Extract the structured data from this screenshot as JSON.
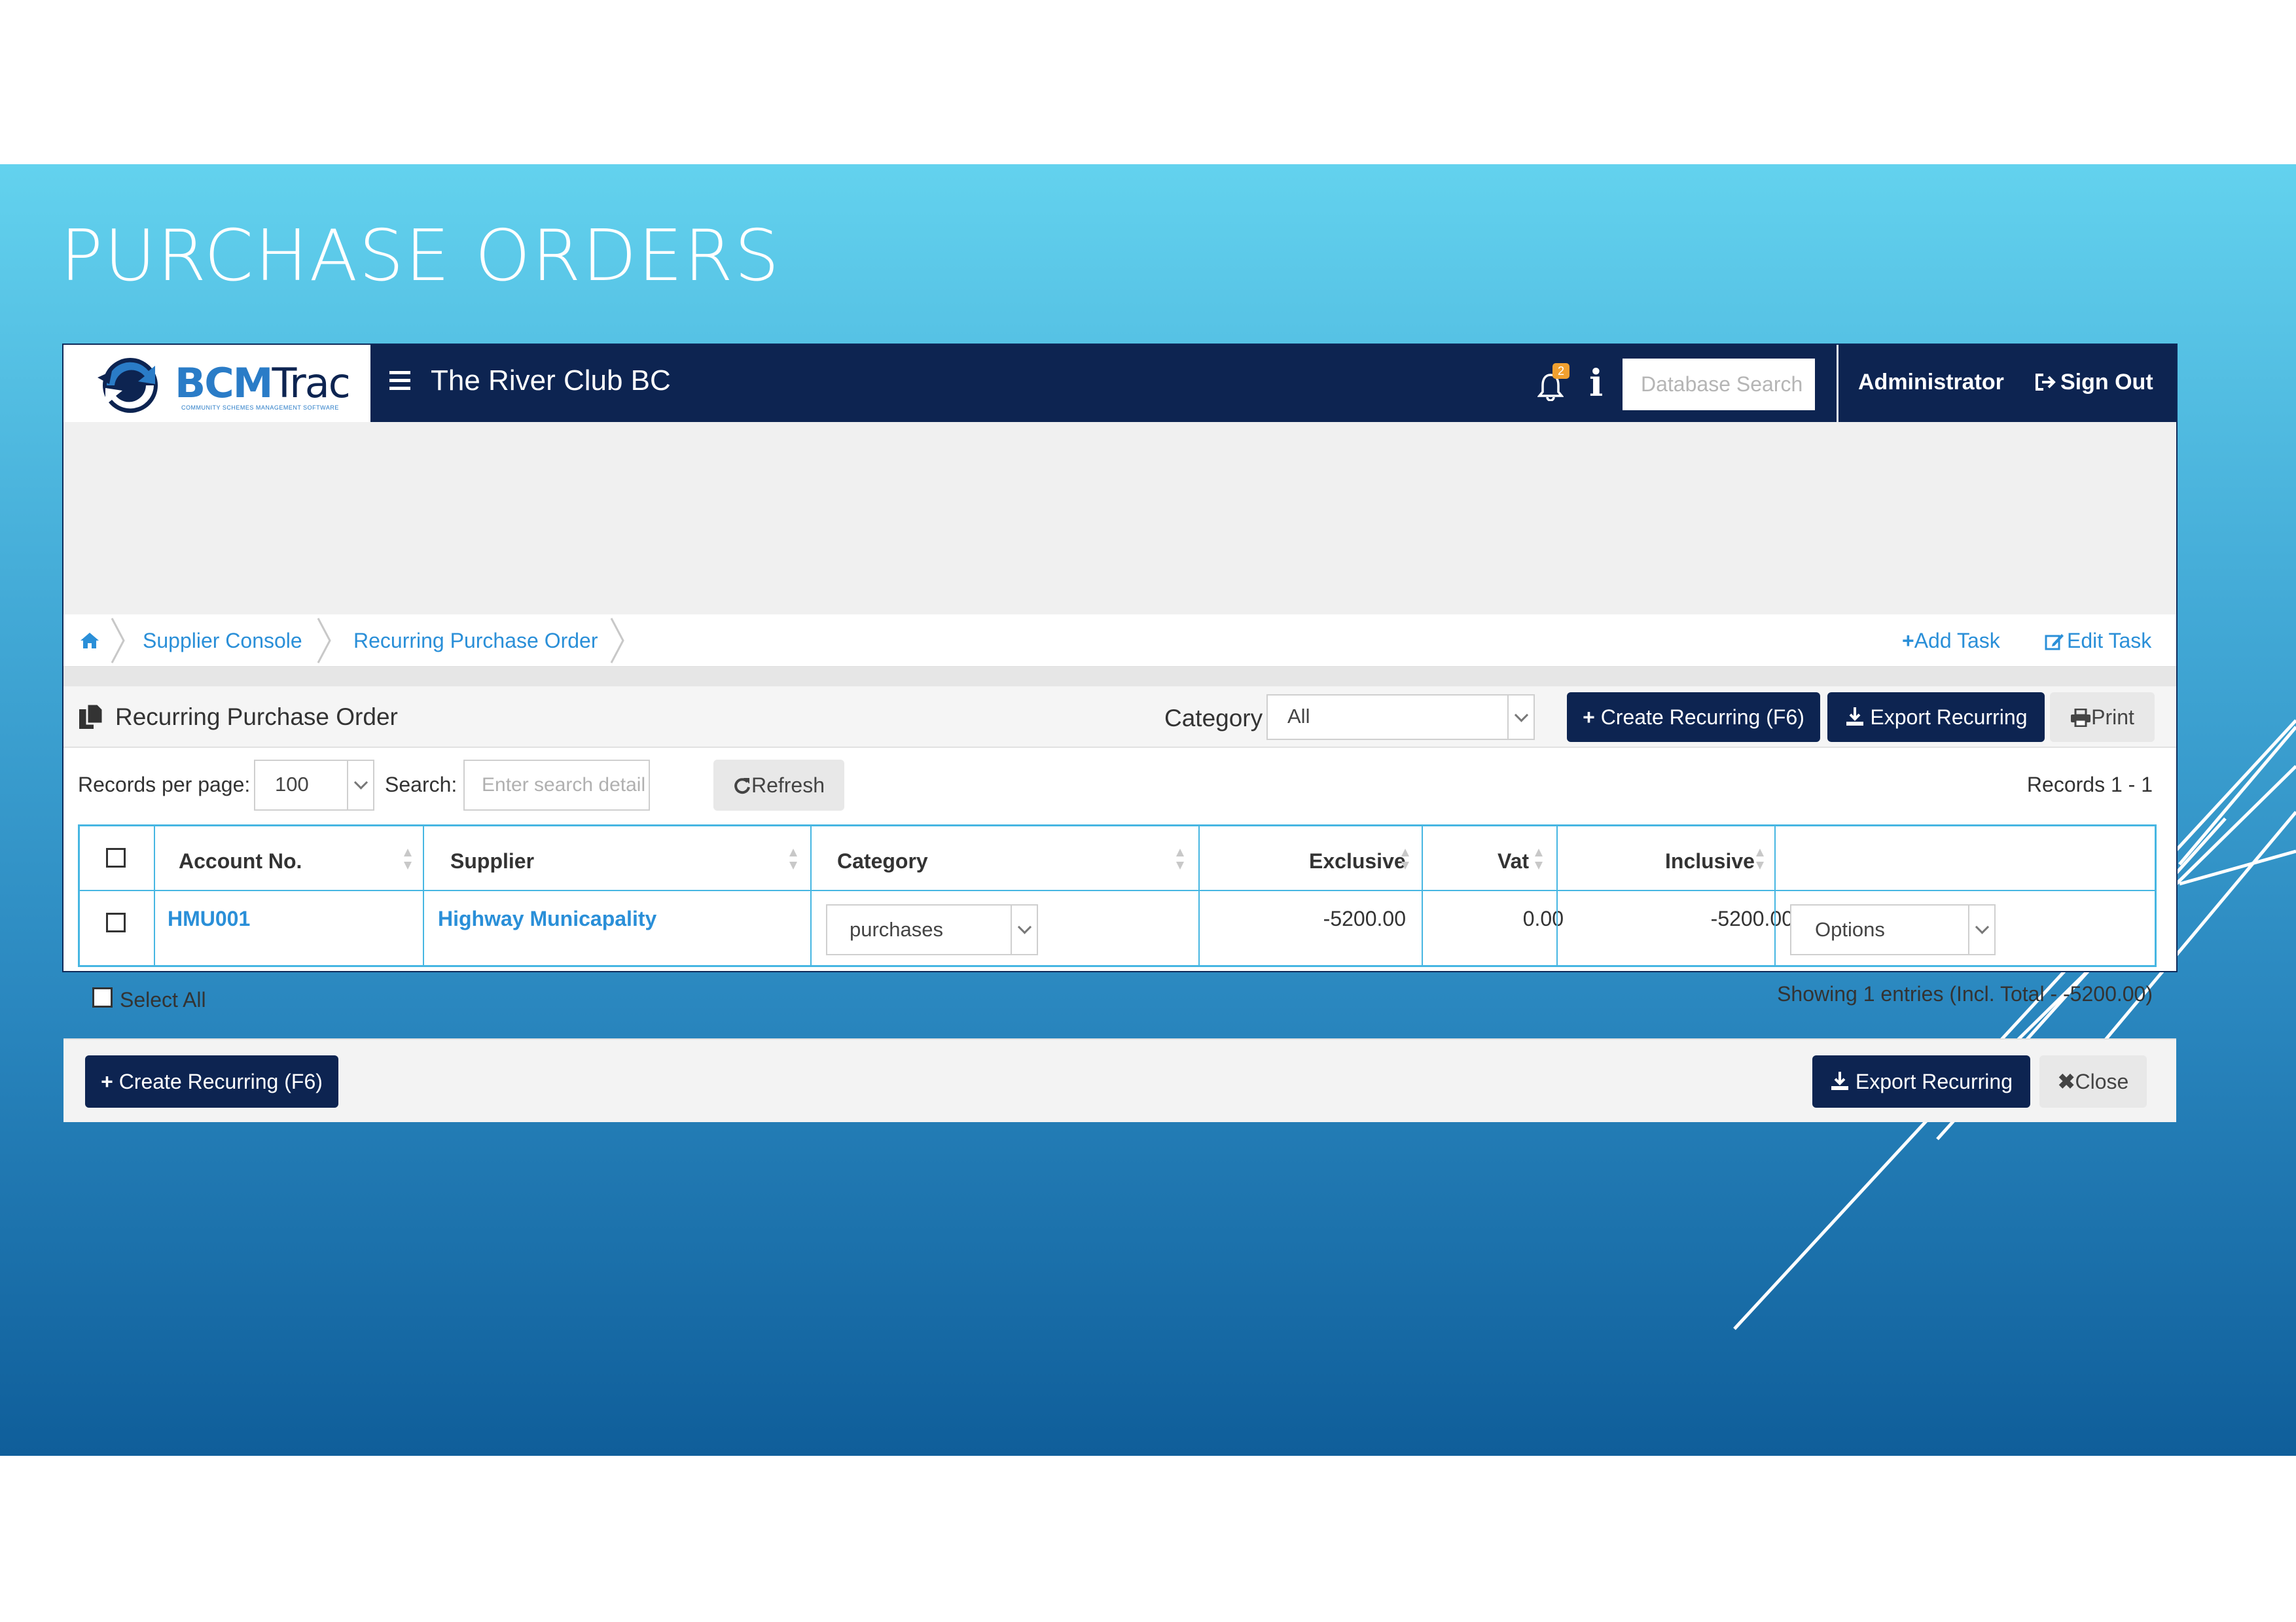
{
  "slide": {
    "title": "PURCHASE ORDERS"
  },
  "app": {
    "logo": {
      "text_part1": "BCM",
      "text_part2": "Trac",
      "tagline": "COMMUNITY SCHEMES MANAGEMENT SOFTWARE"
    },
    "title": "The River Club BC",
    "notification_count": "2",
    "db_search_placeholder": "Database Search",
    "user": "Administrator",
    "sign_out": "Sign Out"
  },
  "breadcrumb": {
    "items": [
      "Supplier Console",
      "Recurring Purchase Order"
    ],
    "add_task": "Add Task",
    "edit_task": "Edit Task"
  },
  "panel": {
    "title": "Recurring Purchase Order",
    "category_label": "Category",
    "category_value": "All",
    "create_button": "Create Recurring (F6)",
    "export_button": "Export Recurring",
    "print_button": "Print"
  },
  "toolbar": {
    "records_per_page_label": "Records per page:",
    "records_per_page_value": "100",
    "search_label": "Search:",
    "search_placeholder": "Enter search detail ..",
    "refresh_button": "Refresh",
    "records_range": "Records 1 - 1"
  },
  "table": {
    "headers": [
      "Account No.",
      "Supplier",
      "Category",
      "Exclusive",
      "Vat",
      "Inclusive"
    ],
    "rows": [
      {
        "account": "HMU001",
        "supplier": "Highway Municapality",
        "category": "purchases",
        "exclusive": "-5200.00",
        "vat": "0.00",
        "inclusive": "-5200.00",
        "options": "Options"
      }
    ]
  },
  "footer": {
    "select_all": "Select All",
    "showing": "Showing 1 entries (Incl. Total - -5200.00)",
    "create_button": "Create Recurring (F6)",
    "export_button": "Export Recurring",
    "close_button": "Close"
  },
  "colors": {
    "navy": "#0d2451",
    "link": "#2a8fd8",
    "table_border": "#46b6e2",
    "badge": "#f0a030"
  }
}
